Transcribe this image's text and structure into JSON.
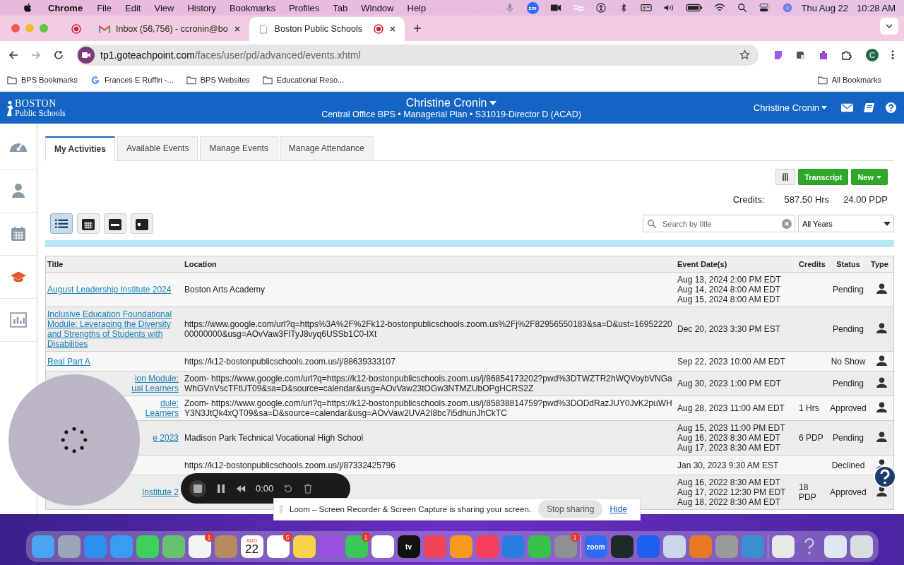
{
  "menu_bar": {
    "app": "Chrome",
    "menus": [
      "File",
      "Edit",
      "View",
      "History",
      "Bookmarks",
      "Profiles",
      "Tab",
      "Window",
      "Help"
    ],
    "zoom_badge": "zm",
    "date": "Thu Aug 22",
    "time": "10:28 AM"
  },
  "browser": {
    "tabs": [
      {
        "kind": "pinned",
        "selected": false,
        "recording": true
      },
      {
        "kind": "mail",
        "title": "Inbox (56,756) - ccronin@bo",
        "selected": false,
        "recording": false
      },
      {
        "kind": "page",
        "title": "Boston Public Schools",
        "selected": true,
        "recording": true
      }
    ],
    "url_host": "tp1.goteachpoint.com",
    "url_path": "/faces/user/pd/advanced/events.xhtml",
    "profile": "C",
    "bookmarks": [
      {
        "kind": "folder-gear",
        "label": "BPS Bookmarks"
      },
      {
        "kind": "google",
        "label": "Frances E Ruffin -..."
      },
      {
        "kind": "folder",
        "label": "BPS Websites"
      },
      {
        "kind": "folder",
        "label": "Educational Reso..."
      }
    ],
    "all_bookmarks": "All Bookmarks"
  },
  "app_header": {
    "logo_top": "BOSTON",
    "logo_bottom": "Public Schools",
    "user": "Christine Cronin",
    "subtitle": "Central Office BPS • Managerial Plan • S31019-Director D (ACAD)",
    "user_menu": "Christine Cronin"
  },
  "sidebar": [
    {
      "kind": "dashboard",
      "selected": false
    },
    {
      "kind": "person",
      "selected": false
    },
    {
      "kind": "calendar",
      "selected": false
    },
    {
      "kind": "cap",
      "selected": true
    },
    {
      "kind": "chart",
      "selected": false
    }
  ],
  "tabs": [
    {
      "label": "My Activities",
      "selected": true
    },
    {
      "label": "Available Events",
      "selected": false
    },
    {
      "label": "Manage Events",
      "selected": false
    },
    {
      "label": "Manage Attendance",
      "selected": false
    }
  ],
  "buttons": {
    "transcript": "Transcript",
    "new": "New"
  },
  "credits": {
    "label": "Credits:",
    "hours": "587.50 Hrs",
    "pdp": "24.00 PDP"
  },
  "views": [
    {
      "kind": "list",
      "selected": true
    },
    {
      "kind": "month",
      "selected": false
    },
    {
      "kind": "week",
      "selected": false
    },
    {
      "kind": "day",
      "selected": false
    }
  ],
  "search": {
    "placeholder": "Search by title"
  },
  "year_filter": "All Years",
  "table": {
    "columns": [
      "Title",
      "Location",
      "Event Date(s)",
      "Credits",
      "Status",
      "Type"
    ],
    "rows": [
      {
        "title": [
          "August Leadership Institute 2024"
        ],
        "partial": false,
        "location": "Boston Arts Academy",
        "dates": [
          "Aug 13, 2024 2:00 PM EDT",
          "Aug 14, 2024 8:00 AM EDT",
          "Aug 15, 2024 8:00 AM EDT"
        ],
        "credits": "",
        "status": "Pending"
      },
      {
        "title": [
          "Inclusive Education Foundational Module: Leveraging the Diversity and Strengths of Students with Disabilities"
        ],
        "partial": false,
        "location": "https://www.google.com/url?q=https%3A%2F%2Fk12-bostonpublicschools.zoom.us%2Fj%2F82956550183&sa=D&ust=1695222000000000&usg=AOvVaw3FlTyJ8vyq6USSb1C0-lXt",
        "dates": [
          "Dec 20, 2023 3:30 PM EST"
        ],
        "credits": "",
        "status": "Pending"
      },
      {
        "title": [
          "Real Part A"
        ],
        "partial": false,
        "location": "https://k12-bostonpublicschools.zoom.us/j/88639333107",
        "dates": [
          "Sep 22, 2023 10:00 AM EDT"
        ],
        "credits": "",
        "status": "No Show"
      },
      {
        "title": [
          "ion Module:",
          "ual Learners"
        ],
        "partial": true,
        "location": "Zoom- https://www.google.com/url?q=https://k12-bostonpublicschools.zoom.us/j/86854173202?pwd%3DTWZTR2hWQVoybVNGaWhGVnVscTFtUT09&sa=D&source=calendar&usg=AOvVaw23tOGw3NTMZUbOPgHCRS2Z",
        "dates": [
          "Aug 30, 2023 1:00 PM EDT"
        ],
        "credits": "",
        "status": "Pending"
      },
      {
        "title": [
          "dule:",
          "Learners"
        ],
        "partial": true,
        "location": "Zoom- https://www.google.com/url?q=https://k12-bostonpublicschools.zoom.us/j/85838814759?pwd%3DODdRazJUY0JvK2puWHY3N3JtQk4xQT09&sa=D&source=calendar&usg=AOvVaw2UVA2I8bc7i5dhunJhCkTC",
        "dates": [
          "Aug 28, 2023 11:00 AM EDT"
        ],
        "credits": "1 Hrs",
        "status": "Approved"
      },
      {
        "title": [
          "e 2023"
        ],
        "partial": true,
        "location": "Madison Park Technical Vocational High School",
        "dates": [
          "Aug 15, 2023 11:00 PM EDT",
          "Aug 16, 2023 8:30 AM EDT",
          "Aug 17, 2023 8:30 AM EDT"
        ],
        "credits": "6 PDP",
        "status": "Pending"
      },
      {
        "title": [],
        "location": "https://k12-bostonpublicschools.zoom.us/j/87332425796",
        "dates": [
          "Jan 30, 2023 9:30 AM EST"
        ],
        "credits": "",
        "status": "Declined"
      },
      {
        "title": [
          "Institute 2"
        ],
        "partial": true,
        "location": "",
        "dates": [
          "Aug 16, 2022 8:30 AM EDT",
          "Aug 17, 2022 12:30 PM EDT",
          "Aug 18, 2022 8:30 AM EDT"
        ],
        "credits": "18 PDP",
        "status": "Approved"
      }
    ]
  },
  "recorder": {
    "time": "0:00"
  },
  "share_notice": {
    "text": "Loom – Screen Recorder & Screen Capture is sharing your screen.",
    "stop": "Stop sharing",
    "hide": "Hide"
  },
  "dock": [
    {
      "kind": "finder"
    },
    {
      "kind": "launchpad"
    },
    {
      "kind": "safari"
    },
    {
      "kind": "mail"
    },
    {
      "kind": "messages"
    },
    {
      "kind": "maps"
    },
    {
      "kind": "photos",
      "badge": "1"
    },
    {
      "kind": "contacts"
    },
    {
      "kind": "calendar",
      "month": "AUG",
      "day": "22"
    },
    {
      "kind": "reminders",
      "badge": "5"
    },
    {
      "kind": "notes"
    },
    {
      "kind": "podcasts"
    },
    {
      "kind": "facetime",
      "badge": "1"
    },
    {
      "kind": "chrome"
    },
    {
      "kind": "tv",
      "label": "tv"
    },
    {
      "kind": "news"
    },
    {
      "kind": "pages"
    },
    {
      "kind": "music"
    },
    {
      "kind": "keynote"
    },
    {
      "kind": "numbers"
    },
    {
      "kind": "settings",
      "badge": "1"
    },
    {
      "kind": "separator"
    },
    {
      "kind": "zoom",
      "label": "zoom"
    },
    {
      "kind": "activity"
    },
    {
      "kind": "wave"
    },
    {
      "kind": "preview"
    },
    {
      "kind": "garageband"
    },
    {
      "kind": "printer"
    },
    {
      "kind": "utility"
    },
    {
      "kind": "separator"
    },
    {
      "kind": "archive"
    },
    {
      "kind": "help"
    },
    {
      "kind": "document"
    },
    {
      "kind": "trash"
    }
  ]
}
